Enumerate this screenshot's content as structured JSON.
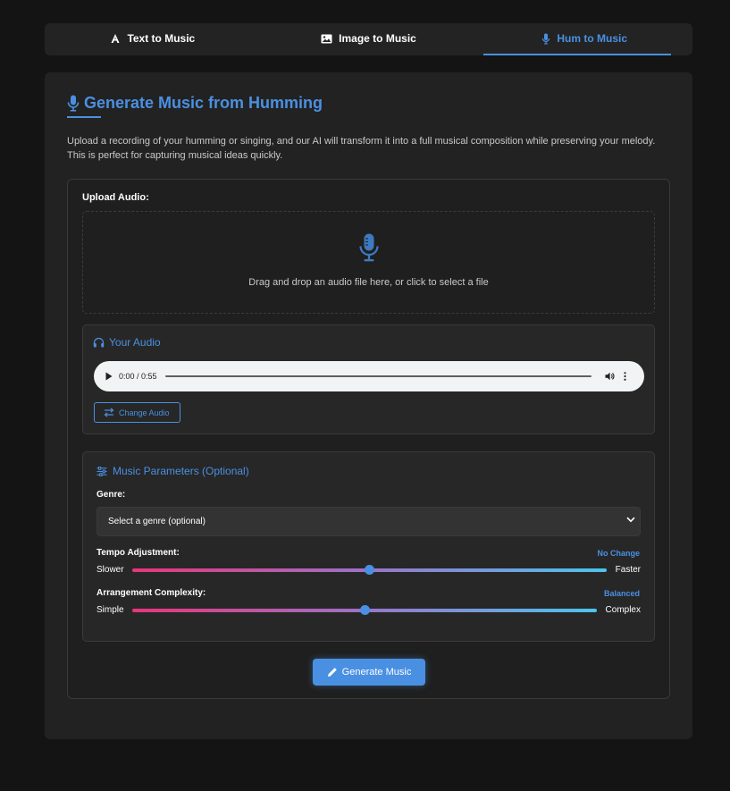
{
  "tabs": [
    {
      "label": "Text to Music",
      "icon": "text-font-icon",
      "active": false
    },
    {
      "label": "Image to Music",
      "icon": "image-icon",
      "active": false
    },
    {
      "label": "Hum to Music",
      "icon": "microphone-icon",
      "active": true
    }
  ],
  "main": {
    "title": "Generate Music from Humming",
    "description": "Upload a recording of your humming or singing, and our AI will transform it into a full musical composition while preserving your melody. This is perfect for capturing musical ideas quickly."
  },
  "upload": {
    "label": "Upload Audio:",
    "drop_text": "Drag and drop an audio file here, or click to select a file"
  },
  "audio": {
    "heading": "Your Audio",
    "time": "0:00 / 0:55",
    "change_label": "Change Audio"
  },
  "params": {
    "heading": "Music Parameters (Optional)",
    "genre_label": "Genre:",
    "genre_selected": "Select a genre (optional)",
    "tempo": {
      "label": "Tempo Adjustment:",
      "value_text": "No Change",
      "min_label": "Slower",
      "max_label": "Faster",
      "level": 0.5
    },
    "complexity": {
      "label": "Arrangement Complexity:",
      "value_text": "Balanced",
      "min_label": "Simple",
      "max_label": "Complex",
      "level": 0.5
    }
  },
  "generate_label": "Generate Music",
  "colors": {
    "accent": "#4a90e2",
    "background": "#141414",
    "card": "#222222",
    "slider_start": "#e8357a",
    "slider_end": "#4cc4ef"
  }
}
